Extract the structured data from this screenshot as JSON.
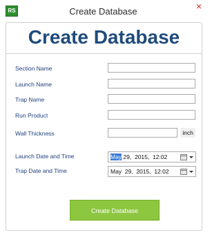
{
  "window": {
    "app_icon_text": "RS",
    "title": "Create Database",
    "close_glyph": "×",
    "close_color": "#d9221c"
  },
  "banner": {
    "title": "Create Database",
    "color": "#1f4b7a"
  },
  "form": {
    "section_name": {
      "label": "Section Name",
      "value": ""
    },
    "launch_name": {
      "label": "Launch Name",
      "value": ""
    },
    "trap_name": {
      "label": "Trap Name",
      "value": ""
    },
    "run_product": {
      "label": "Run Product",
      "value": ""
    },
    "wall_thickness": {
      "label": "Wall Thickness",
      "value": "",
      "unit": "inch"
    },
    "launch_datetime": {
      "label": "Launch Date and Time",
      "month": "May",
      "rest": " 29,  2015,  12:02",
      "icon": "calendar-icon"
    },
    "trap_datetime": {
      "label": "Trap Date and Time",
      "value": "May  29,  2015,  12:02",
      "icon": "calendar-icon"
    }
  },
  "actions": {
    "create_label": "Create Database",
    "create_color": "#8dc63f"
  }
}
